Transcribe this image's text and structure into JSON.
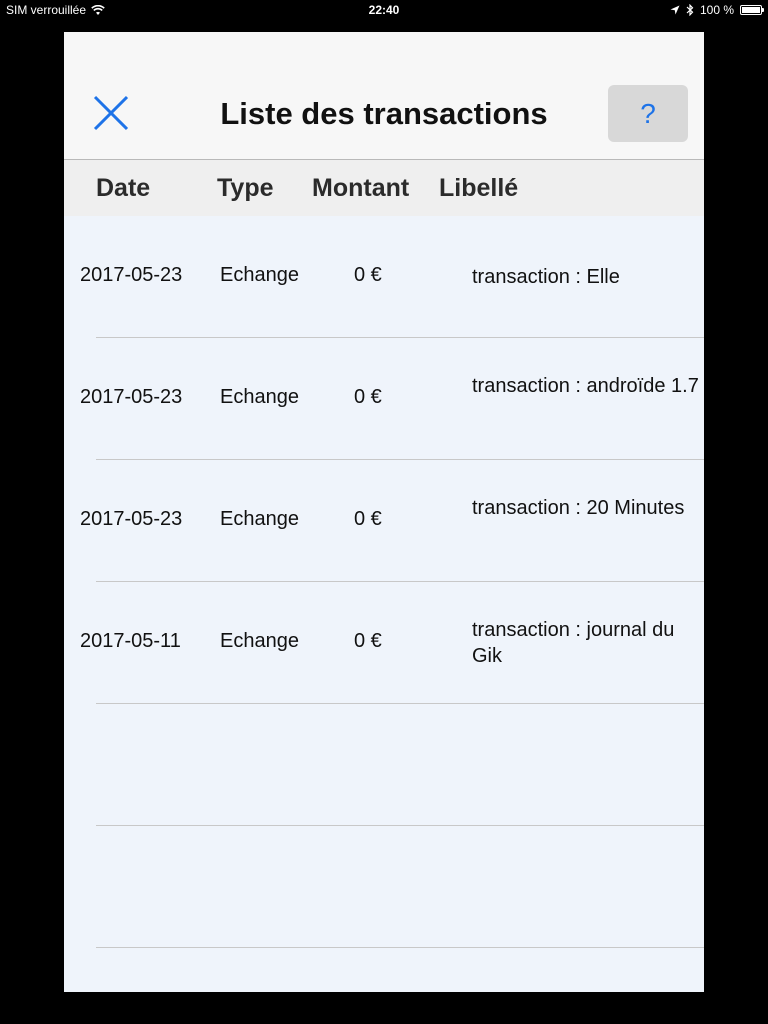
{
  "status_bar": {
    "carrier": "SIM verrouillée",
    "time": "22:40",
    "battery": "100 %"
  },
  "nav": {
    "title": "Liste des transactions",
    "close_icon": "close-icon",
    "help_label": "?"
  },
  "columns": {
    "date": "Date",
    "type": "Type",
    "amount": "Montant",
    "label": "Libellé"
  },
  "rows": [
    {
      "date": "2017-05-23",
      "type": "Echange",
      "amount": "0 €",
      "label": "transaction : Elle"
    },
    {
      "date": "2017-05-23",
      "type": "Echange",
      "amount": "0 €",
      "label": "transaction : androïde 1.7"
    },
    {
      "date": "2017-05-23",
      "type": "Echange",
      "amount": "0 €",
      "label": "transaction : 20 Minutes"
    },
    {
      "date": "2017-05-11",
      "type": "Echange",
      "amount": "0 €",
      "label": "transaction : journal du Gik"
    },
    {
      "date": "",
      "type": "",
      "amount": "",
      "label": ""
    },
    {
      "date": "",
      "type": "",
      "amount": "",
      "label": ""
    }
  ],
  "colors": {
    "accent": "#1e73e8",
    "panel_background": "#eff4fb",
    "navbar_background": "#f7f7f7"
  }
}
